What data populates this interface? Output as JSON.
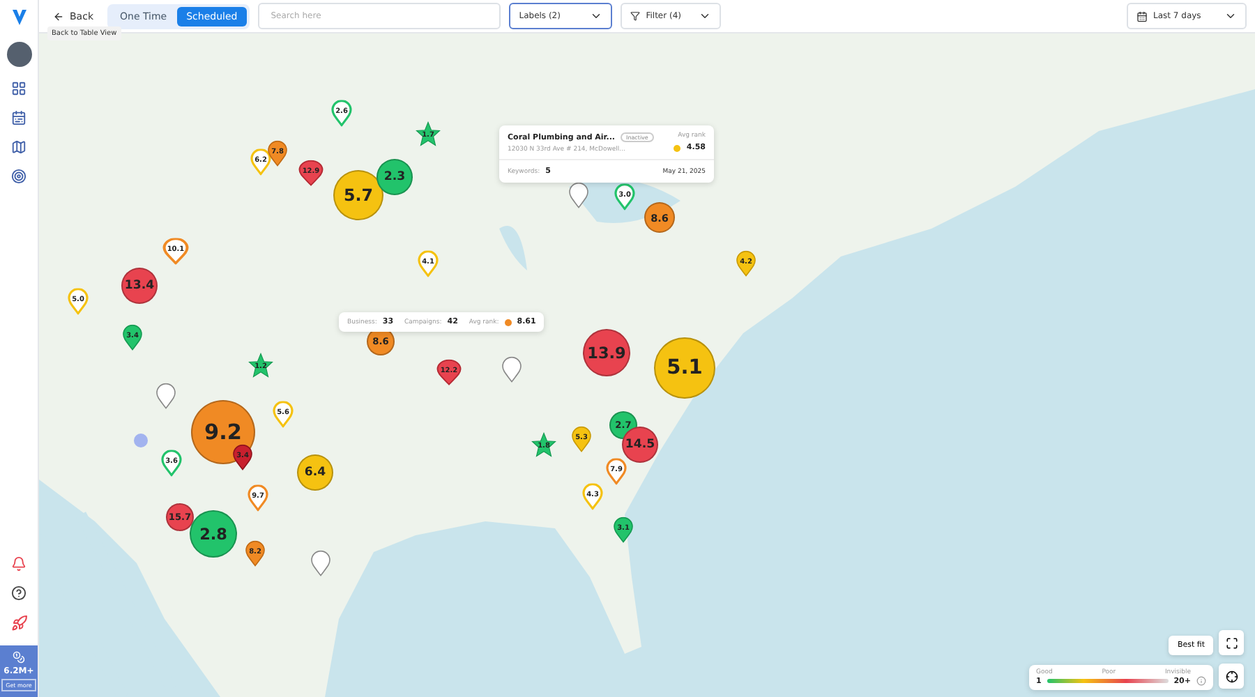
{
  "toolbar": {
    "back": "Back",
    "back_tooltip": "Back to Table View",
    "modes": [
      {
        "label": "One Time",
        "selected": false
      },
      {
        "label": "Scheduled",
        "selected": true
      }
    ],
    "search": {
      "placeholder": "Search here"
    },
    "labels": "Labels (2)",
    "filter": "Filter (4)",
    "date_range": "Last 7 days"
  },
  "sidebar": {
    "credits": "6.2M+",
    "cta": "Get more"
  },
  "markers": [
    {
      "kind": "outline-pin",
      "value": "2.6",
      "color": "#22c36b"
    },
    {
      "kind": "star",
      "value": "1.7",
      "color": "#22c36b"
    },
    {
      "kind": "outline-pin",
      "value": "6.2",
      "color": "#f5c211"
    },
    {
      "kind": "pin",
      "value": "7.8",
      "color": "#f08a24"
    },
    {
      "kind": "pin",
      "value": "12.9",
      "color": "#e8434f"
    },
    {
      "kind": "cluster",
      "value": "5.7",
      "color": "#f5c211"
    },
    {
      "kind": "cluster",
      "value": "2.3",
      "color": "#22c36b"
    },
    {
      "kind": "outline-pin",
      "value": "3.0",
      "color": "#22c36b"
    },
    {
      "kind": "empty-pin"
    },
    {
      "kind": "cluster",
      "value": "8.6",
      "color": "#f08a24"
    },
    {
      "kind": "pin",
      "value": "4.2",
      "color": "#f5c211"
    },
    {
      "kind": "outline-pin",
      "value": "10.1",
      "color": "#f08a24"
    },
    {
      "kind": "cluster",
      "value": "13.4",
      "color": "#e8434f"
    },
    {
      "kind": "outline-pin",
      "value": "4.1",
      "color": "#f5c211"
    },
    {
      "kind": "outline-pin",
      "value": "5.0",
      "color": "#f5c211"
    },
    {
      "kind": "pin",
      "value": "3.4",
      "color": "#22c36b"
    },
    {
      "kind": "cluster",
      "value": "8.6",
      "color": "#f08a24"
    },
    {
      "kind": "star",
      "value": "1.2",
      "color": "#22c36b"
    },
    {
      "kind": "pin",
      "value": "12.2",
      "color": "#e8434f"
    },
    {
      "kind": "empty-pin"
    },
    {
      "kind": "cluster",
      "value": "13.9",
      "color": "#e8434f"
    },
    {
      "kind": "cluster",
      "value": "5.1",
      "color": "#f5c211"
    },
    {
      "kind": "empty-pin"
    },
    {
      "kind": "cluster",
      "value": "9.2",
      "color": "#f08a24"
    },
    {
      "kind": "outline-pin",
      "value": "5.6",
      "color": "#f5c211"
    },
    {
      "kind": "outline-pin",
      "value": "3.6",
      "color": "#22c36b"
    },
    {
      "kind": "pin",
      "value": "3.4",
      "color": "#c8202e"
    },
    {
      "kind": "cluster",
      "value": "6.4",
      "color": "#f5c211"
    },
    {
      "kind": "star",
      "value": "1.8",
      "color": "#22c36b"
    },
    {
      "kind": "pin",
      "value": "5.3",
      "color": "#f5c211"
    },
    {
      "kind": "cluster",
      "value": "2.7",
      "color": "#22c36b"
    },
    {
      "kind": "cluster",
      "value": "14.5",
      "color": "#e8434f"
    },
    {
      "kind": "outline-pin",
      "value": "9.7",
      "color": "#f08a24"
    },
    {
      "kind": "cluster",
      "value": "15.7",
      "color": "#e8434f"
    },
    {
      "kind": "cluster",
      "value": "2.8",
      "color": "#22c36b"
    },
    {
      "kind": "outline-pin",
      "value": "7.9",
      "color": "#f08a24"
    },
    {
      "kind": "outline-pin",
      "value": "4.3",
      "color": "#f5c211"
    },
    {
      "kind": "pin",
      "value": "3.1",
      "color": "#22c36b"
    },
    {
      "kind": "pin",
      "value": "8.2",
      "color": "#f08a24"
    },
    {
      "kind": "empty-pin"
    }
  ],
  "popup": {
    "name": "Coral Plumbing and Air...",
    "status": "Inactive",
    "address": "12030 N 33rd Ave # 214, McDowell...",
    "rank_label": "Avg rank",
    "rank": "4.58",
    "keywords_label": "Keywords:",
    "keywords": "5",
    "date": "May 21, 2025"
  },
  "summary": {
    "business_label": "Business:",
    "business": "33",
    "campaigns_label": "Campaigns:",
    "campaigns": "42",
    "rank_label": "Avg rank:",
    "rank": "8.61"
  },
  "best_fit": "Best fit",
  "legend": {
    "good": "Good",
    "poor": "Poor",
    "invisible": "Invisible",
    "min": "1",
    "max": "20+"
  }
}
